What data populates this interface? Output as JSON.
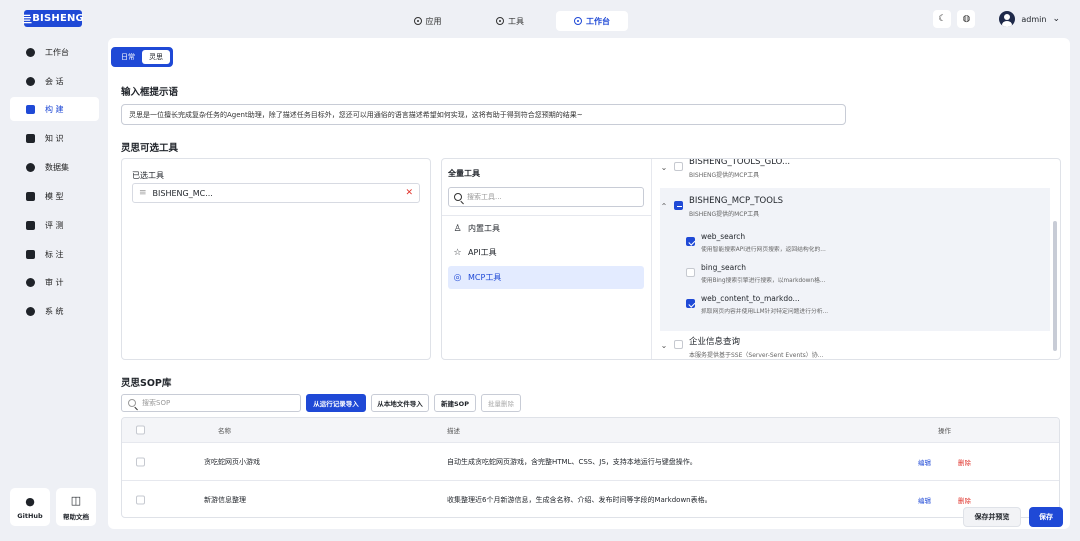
{
  "brand": "BISHENG",
  "brand_mark": "亖",
  "nav": [
    {
      "label": "应用"
    },
    {
      "label": "工具"
    },
    {
      "label": "工作台"
    }
  ],
  "user": {
    "name": "admin"
  },
  "sidebar": {
    "items": [
      {
        "label": "工作台"
      },
      {
        "label": "会  话"
      },
      {
        "label": "构  建"
      },
      {
        "label": "知  识"
      },
      {
        "label": "数据集"
      },
      {
        "label": "模  型"
      },
      {
        "label": "评  测"
      },
      {
        "label": "标  注"
      },
      {
        "label": "审  计"
      },
      {
        "label": "系  统"
      }
    ],
    "bottom": [
      {
        "label": "GitHub"
      },
      {
        "label": "帮助文档"
      }
    ]
  },
  "mode_tabs": [
    {
      "label": "日常"
    },
    {
      "label": "灵思"
    }
  ],
  "prompt_section": {
    "title": "输入框提示语",
    "value": "灵思是一位擅长完成复杂任务的Agent助理，除了描述任务目标外，您还可以用通俗的语言描述希望如何实现，这将有助于得到符合您预期的结果~"
  },
  "tools_section": {
    "title": "灵思可选工具",
    "selected_title": "已选工具",
    "selected": [
      {
        "name": "BISHENG_MC..."
      }
    ],
    "all_title": "全量工具",
    "search_placeholder": "搜索工具...",
    "categories": [
      {
        "label": "内置工具"
      },
      {
        "label": "API工具"
      },
      {
        "label": "MCP工具"
      }
    ],
    "groups": [
      {
        "name": "BISHENG_TOOLS_GLO...",
        "desc": "BISHENG提供的MCP工具"
      },
      {
        "name": "BISHENG_MCP_TOOLS",
        "desc": "BISHENG提供的MCP工具",
        "tools": [
          {
            "name": "web_search",
            "desc": "使用智能搜索API进行网页搜索，返回结构化的..."
          },
          {
            "name": "bing_search",
            "desc": "使用Bing搜索引擎进行搜索，以markdown格..."
          },
          {
            "name": "web_content_to_markdo...",
            "desc": "抓取网页内容并使用LLM针对特定问题进行分析..."
          }
        ]
      },
      {
        "name": "企业信息查询",
        "desc": "本服务提供基于SSE（Server-Sent Events）协..."
      }
    ]
  },
  "sop_section": {
    "title": "灵思SOP库",
    "search_placeholder": "搜索SOP",
    "buttons": {
      "import_run": "从运行记录导入",
      "import_local": "从本地文件导入",
      "new": "新建SOP",
      "batch_delete": "批量删除"
    },
    "columns": {
      "name": "名称",
      "desc": "描述",
      "ops": "操作"
    },
    "rows": [
      {
        "name": "贪吃蛇网页小游戏",
        "desc": "自动生成贪吃蛇网页游戏，含完整HTML、CSS、JS，支持本地运行与键盘操作。",
        "edit": "编辑",
        "delete": "删除"
      },
      {
        "name": "新游信息整理",
        "desc": "收集整理近6个月新游信息，生成含名称、介绍、发布时间等字段的Markdown表格。",
        "edit": "编辑",
        "delete": "删除"
      }
    ]
  },
  "footer": {
    "save_preview": "保存并预览",
    "save": "保存"
  },
  "colors": {
    "primary": "#1f49d6",
    "danger": "#e0332b",
    "bg": "#eef0f5"
  }
}
